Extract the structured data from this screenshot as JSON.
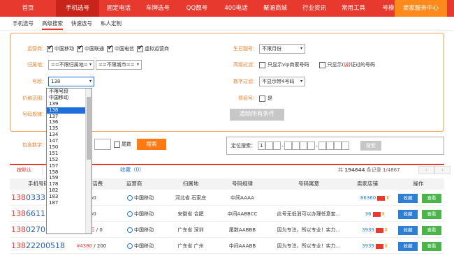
{
  "nav": {
    "items": [
      "首页",
      "手机选号",
      "固定电话",
      "车牌选号",
      "QQ靓号",
      "400电话",
      "聚涵商城",
      "行业资讯",
      "常用工具",
      "号模"
    ],
    "active_index": 1,
    "seller": "卖家服务中心"
  },
  "subtabs": {
    "items": [
      "手机选号",
      "高级搜索",
      "快速选号",
      "私人定制"
    ],
    "active_index": 1
  },
  "filter": {
    "carrier_label": "运营商：",
    "carriers": [
      {
        "label": "中国移动",
        "checked": true
      },
      {
        "label": "中国联通",
        "checked": true
      },
      {
        "label": "中国电信",
        "checked": true
      },
      {
        "label": "虚拟运营商",
        "checked": true
      }
    ],
    "region_label": "归属地：",
    "province_select": "==不限归属地=",
    "city_select": "==不限城市==",
    "segment_label": "号段：",
    "segment_value": "138",
    "price_label": "价格范围：",
    "pattern_label": "号码规律：",
    "contain_label": "包含数字：",
    "tail_label": "尾数",
    "search_button": "搜索",
    "birthday_label": "生日靓号：",
    "birthday_select": "不限月份",
    "advanced_label": "高级过滤：",
    "vip_only": "只显示vip商家号码",
    "cert_only_pre": "只显示(",
    "cert_only_mark": "诚",
    "cert_only_post": ")证过的号码",
    "digit_filter_label": "数字过滤：",
    "digit_filter_select": "不显示带4号码",
    "couple_label": "情侣号：",
    "couple_option": "是",
    "clear_button": "清除所有条件"
  },
  "dropdown": {
    "options": [
      "不限号段",
      "中国移动",
      "139",
      "138",
      "137",
      "136",
      "135",
      "134",
      "147",
      "150",
      "151",
      "152",
      "157",
      "158",
      "159",
      "178",
      "182",
      "183",
      "187"
    ],
    "highlight_index": 3
  },
  "locate": {
    "label": "定位搜索：",
    "first_digit": "1",
    "search_button": "搜索"
  },
  "list": {
    "default_tab": "按默认",
    "favorites": "收藏（0）",
    "total_prefix": "共",
    "total": "194644",
    "total_suffix": "条记录",
    "page": "1",
    "pages": "/4867",
    "prev": "‹",
    "next": "›"
  },
  "table": {
    "headers": [
      "手机号码",
      "售价/话费",
      "运营商",
      "归属地",
      "号码规律",
      "号码寓意",
      "卖家店铺",
      "操作"
    ],
    "rows": [
      {
        "prefix": "138",
        "rest": "0333",
        "price": "",
        "fee": "/ 50",
        "carrier": "中国移动",
        "region": "河北省 石家庄",
        "pattern": "中间AAAA",
        "meaning": "",
        "shop": "86360",
        "fav": "收藏",
        "view": "查看"
      },
      {
        "prefix": "138",
        "rest": "6611",
        "price": "",
        "fee": "/ 50",
        "carrier": "中国移动",
        "region": "安徽省 合肥",
        "pattern": "中间AABBCC",
        "meaning": "此号无低消可以办理任意套...",
        "shop": "36",
        "fav": "收藏",
        "view": "查看"
      },
      {
        "prefix": "138",
        "rest": "0270",
        "price": "¥45万",
        "fee": "/ 0",
        "carrier": "中国移动",
        "region": "广东省 深圳",
        "pattern": "尾数AABBB",
        "meaning": "因为专注，所以专业！实力...",
        "shop": "3939",
        "fav": "收藏",
        "view": "查看"
      },
      {
        "prefix": "138",
        "rest": "22200518",
        "price": "¥4380",
        "fee": "/ 200",
        "carrier": "中国移动",
        "region": "广东省 广州",
        "pattern": "中间AAABB",
        "meaning": "因为专注，所以专业！实力...",
        "shop": "3939",
        "fav": "收藏",
        "view": "查看"
      }
    ]
  },
  "colors": {
    "brand_red": "#e8392f",
    "orange": "#ff7a12",
    "blue": "#2c7fd4",
    "green": "#49b54a"
  }
}
